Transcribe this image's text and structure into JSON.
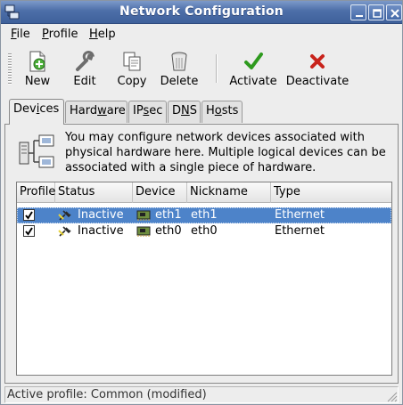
{
  "window": {
    "title": "Network Configuration",
    "icon": "network-config-icon",
    "controls": [
      "minimize-icon",
      "maximize-icon",
      "close-icon"
    ]
  },
  "menubar": {
    "file": {
      "u": "F",
      "rest": "ile"
    },
    "profile": {
      "u": "P",
      "rest": "rofile"
    },
    "help": {
      "u": "H",
      "rest": "elp"
    }
  },
  "toolbar": {
    "new_label": "New",
    "edit_label": "Edit",
    "copy_label": "Copy",
    "delete_label": "Delete",
    "activate_label": "Activate",
    "deactivate_label": "Deactivate"
  },
  "tabs": {
    "devices": {
      "pre": "Dev",
      "u": "i",
      "post": "ces"
    },
    "hardware": {
      "pre": "Hard",
      "u": "w",
      "post": "are"
    },
    "ipsec": {
      "pre": "IP",
      "u": "s",
      "post": "ec"
    },
    "dns": {
      "pre": "D",
      "u": "N",
      "post": "S"
    },
    "hosts": {
      "pre": "H",
      "u": "o",
      "post": "sts"
    }
  },
  "devices_panel": {
    "info_text": "You may configure network devices associated with physical hardware here.  Multiple logical devices can be associated with a single piece of hardware.",
    "columns": [
      "Profile",
      "Status",
      "Device",
      "Nickname",
      "Type"
    ],
    "rows": [
      {
        "profile_checked": true,
        "status": "Inactive",
        "device": "eth1",
        "nickname": "eth1",
        "type": "Ethernet",
        "selected": true
      },
      {
        "profile_checked": true,
        "status": "Inactive",
        "device": "eth0",
        "nickname": "eth0",
        "type": "Ethernet",
        "selected": false
      }
    ]
  },
  "statusbar": {
    "text": "Active profile: Common (modified)"
  },
  "colors": {
    "titlebar": "#4c6ea8",
    "selection": "#4d83c9",
    "activate_green": "#2e9a1e",
    "deactivate_red": "#c8231b"
  }
}
